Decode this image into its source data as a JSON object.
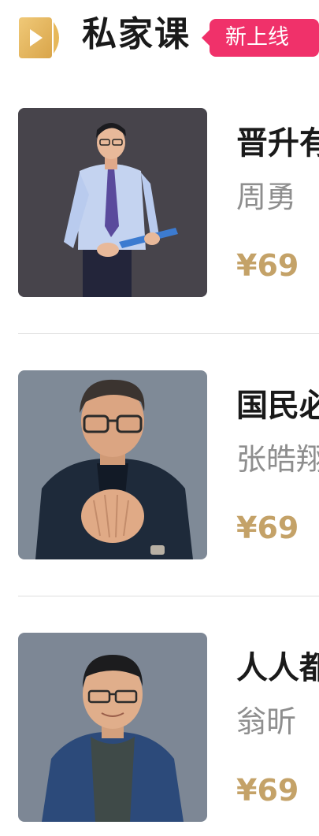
{
  "header": {
    "title": "私家课",
    "badge": "新上线",
    "logo_icon": "video-play-icon",
    "logo_color": "#e7b85a"
  },
  "courses": [
    {
      "title": "晋升有",
      "teacher": "周勇",
      "price": "¥69",
      "photo": "teacher-portrait-1"
    },
    {
      "title": "国民必",
      "teacher": "张皓翔",
      "price": "¥69",
      "photo": "teacher-portrait-2"
    },
    {
      "title": "人人都",
      "teacher": "翁昕",
      "price": "¥69",
      "photo": "teacher-portrait-3"
    }
  ],
  "colors": {
    "badge_bg": "#f0316a",
    "price": "#c4a268",
    "teacher": "#8e8e8e",
    "title": "#1a1a1a"
  }
}
